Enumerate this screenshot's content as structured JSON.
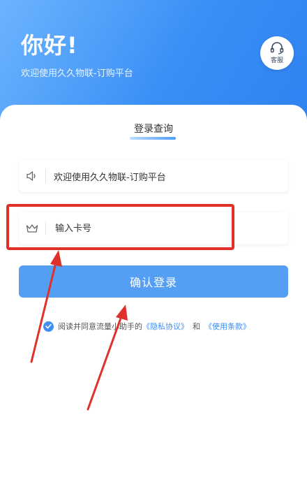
{
  "header": {
    "greeting": "你好!",
    "subtitle": "欢迎使用久久物联-订购平台",
    "customer_service_label": "客服",
    "icon": "headset-icon"
  },
  "tabs": {
    "active_label": "登录查询"
  },
  "notice": {
    "icon": "speaker-icon",
    "text": "欢迎使用久久物联-订购平台"
  },
  "card_input": {
    "icon": "crown-icon",
    "placeholder": "输入卡号",
    "value": ""
  },
  "login_button": {
    "label": "确认登录"
  },
  "agreement": {
    "checked": true,
    "prefix": "阅读并同意流量小助手的",
    "privacy_link": "《隐私协议》",
    "and": "和",
    "terms_link": "《使用条款》"
  },
  "colors": {
    "accent": "#3f8ef2",
    "button": "#549ef4",
    "annotation_red": "#e0302a"
  }
}
